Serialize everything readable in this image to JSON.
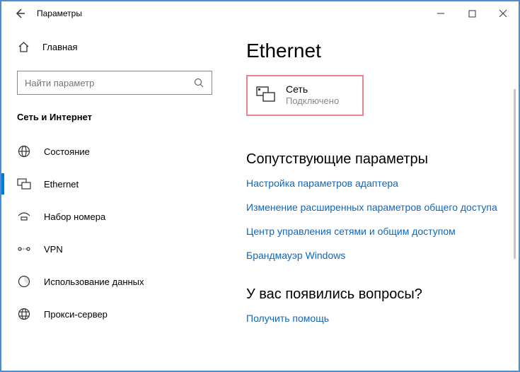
{
  "titlebar": {
    "title": "Параметры"
  },
  "sidebar": {
    "home_label": "Главная",
    "search_placeholder": "Найти параметр",
    "section_label": "Сеть и Интернет",
    "items": [
      {
        "label": "Состояние"
      },
      {
        "label": "Ethernet"
      },
      {
        "label": "Набор номера"
      },
      {
        "label": "VPN"
      },
      {
        "label": "Использование данных"
      },
      {
        "label": "Прокси-сервер"
      }
    ]
  },
  "main": {
    "page_title": "Ethernet",
    "network": {
      "name": "Сеть",
      "status": "Подключено"
    },
    "related_heading": "Сопутствующие параметры",
    "links": [
      "Настройка параметров адаптера",
      "Изменение расширенных параметров общего доступа",
      "Центр управления сетями и общим доступом",
      "Брандмауэр Windows"
    ],
    "questions_heading": "У вас появились вопросы?",
    "help_link": "Получить помощь"
  }
}
